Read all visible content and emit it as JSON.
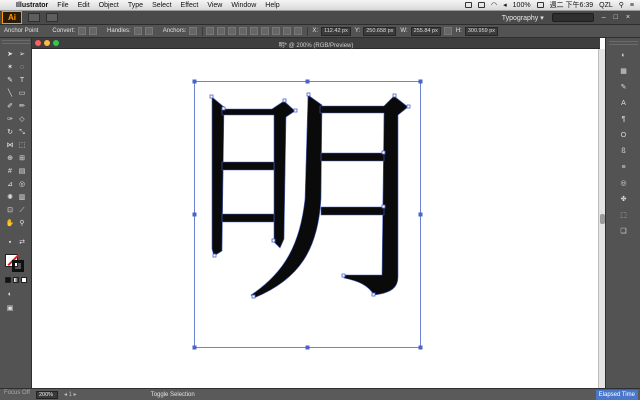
{
  "menubar": {
    "app_name": "Illustrator",
    "items": [
      "File",
      "Edit",
      "Object",
      "Type",
      "Select",
      "Effect",
      "View",
      "Window",
      "Help"
    ],
    "battery": "100%",
    "clock": "週二 下午6:39",
    "user": "QZL"
  },
  "appbar": {
    "logo": "Ai",
    "workspace": "Typography",
    "workspace_arrow": "▾"
  },
  "control_bar": {
    "tool_name": "Anchor Point",
    "convert_label": "Convert:",
    "handles_label": "Handles:",
    "anchors_label": "Anchors:",
    "x_value": "112.42 px",
    "y_value": "250.658 px",
    "w_value": "255.84 px",
    "h_value": "300.959 px"
  },
  "document": {
    "tab_title": "明* @ 200% (RGB/Preview)",
    "character": "明"
  },
  "status": {
    "zoom": "200%",
    "left_text": "Focus Off",
    "selection_text": "Toggle Selection",
    "right_text": "Elapsed Time"
  },
  "colors": {
    "accent": "#ff9a00",
    "path_blue": "#4a63c8",
    "ui_gray": "#535353"
  }
}
